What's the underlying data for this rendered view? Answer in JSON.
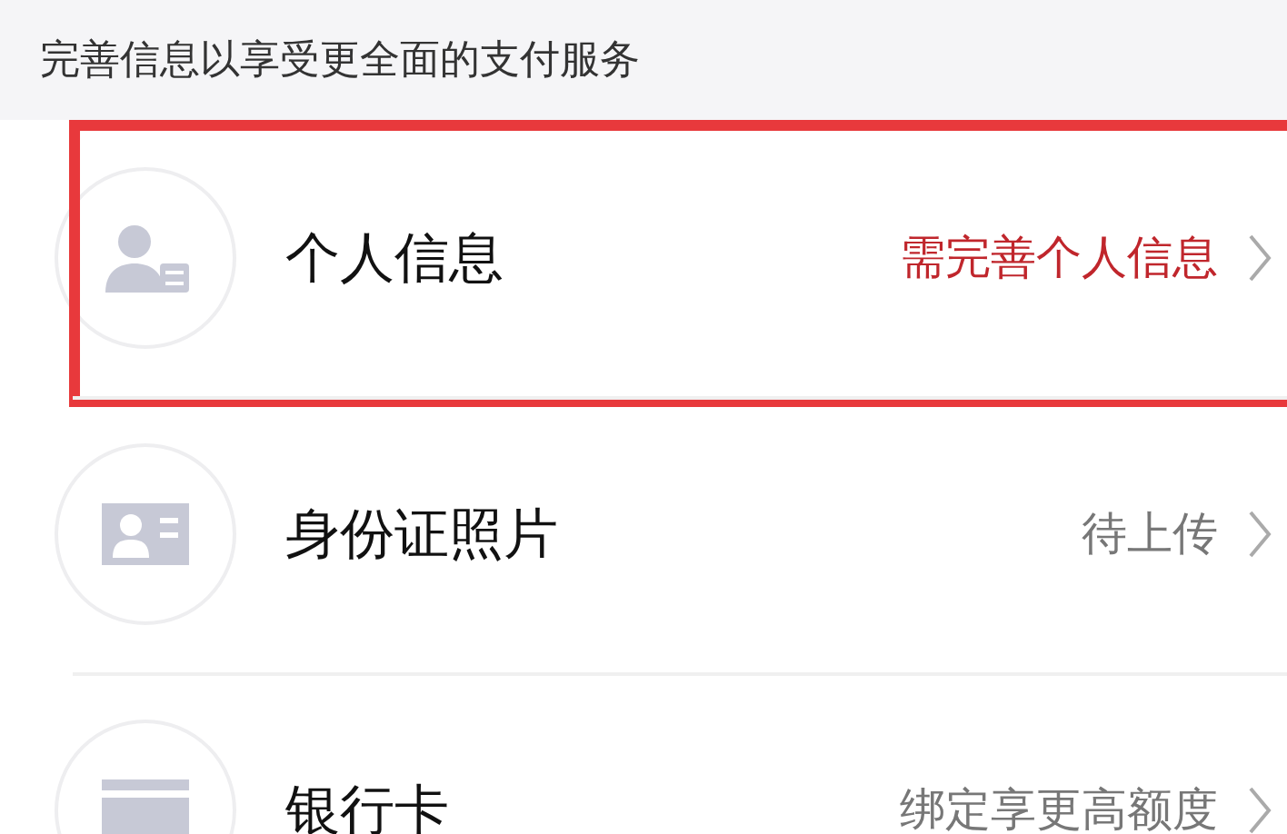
{
  "header": {
    "text": "完善信息以享受更全面的支付服务"
  },
  "rows": [
    {
      "kind": "person",
      "title": "个人信息",
      "status": "需完善个人信息",
      "alert": true,
      "highlighted": true
    },
    {
      "kind": "idcard",
      "title": "身份证照片",
      "status": "待上传",
      "alert": false,
      "highlighted": false
    },
    {
      "kind": "card",
      "title": "银行卡",
      "status": "绑定享更高额度",
      "alert": false,
      "highlighted": false
    }
  ]
}
